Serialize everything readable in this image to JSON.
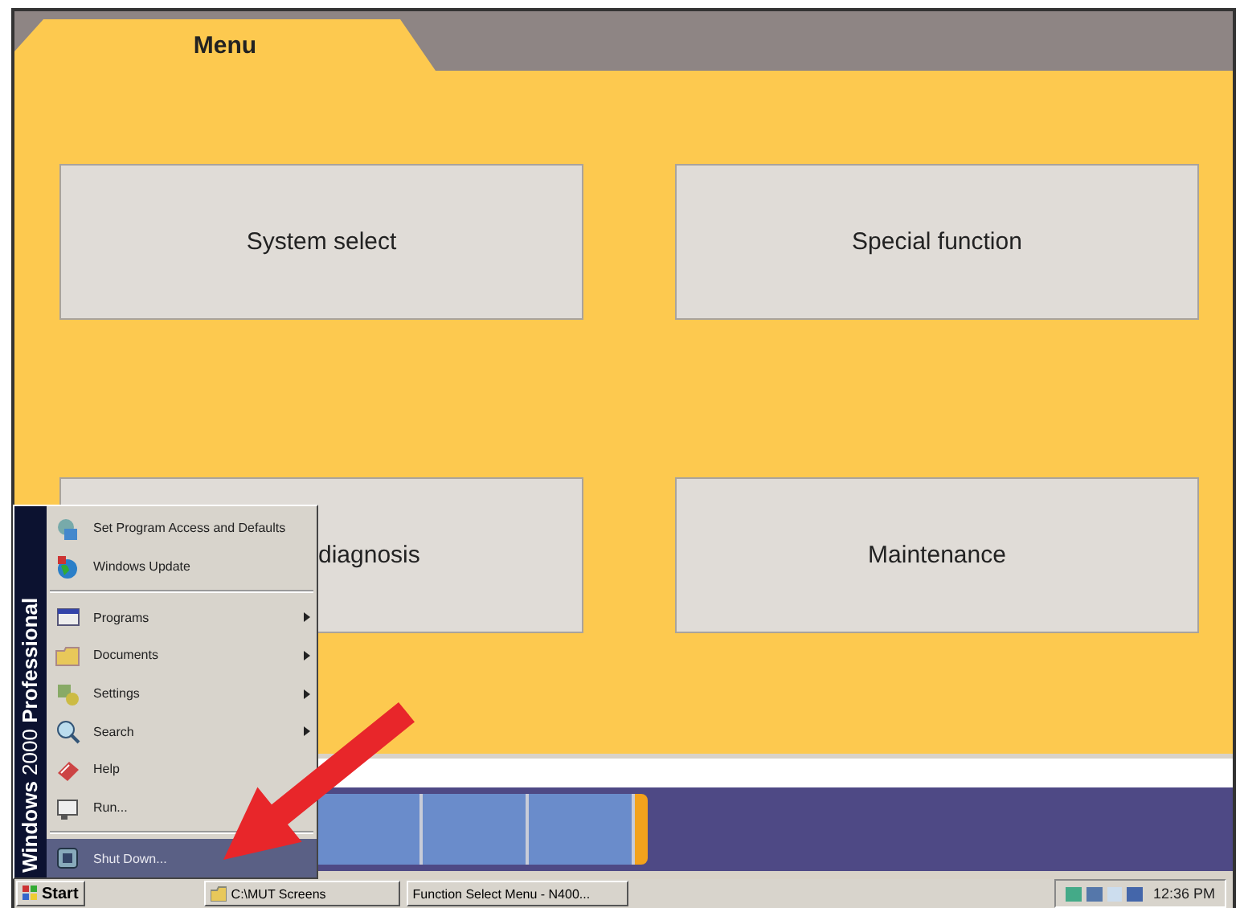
{
  "tabs": [
    {
      "label": "Menu",
      "selected": true
    }
  ],
  "menu_buttons": [
    {
      "label": "System select",
      "kind": "full"
    },
    {
      "label": "Special function",
      "kind": "full"
    },
    {
      "label": "diagnosis",
      "kind": "covered"
    },
    {
      "label": "Maintenance",
      "kind": "full"
    }
  ],
  "start_menu": {
    "banner": "**Windows** 2000 **Professional**",
    "items": [
      {
        "kind": "item",
        "label": "Set Program Access and Defaults",
        "submenu": false,
        "selected": false
      },
      {
        "kind": "item",
        "label": "Windows Update",
        "submenu": false,
        "selected": false
      },
      {
        "kind": "separator"
      },
      {
        "kind": "item",
        "label": "Programs",
        "submenu": true,
        "selected": false
      },
      {
        "kind": "item",
        "label": "Documents",
        "submenu": true,
        "selected": false
      },
      {
        "kind": "item",
        "label": "Settings",
        "submenu": true,
        "selected": false
      },
      {
        "kind": "item",
        "label": "Search",
        "submenu": true,
        "selected": false
      },
      {
        "kind": "item",
        "label": "Help",
        "submenu": false,
        "selected": false
      },
      {
        "kind": "item",
        "label": "Run...",
        "submenu": false,
        "selected": false
      },
      {
        "kind": "separator"
      },
      {
        "kind": "item",
        "label": "Shut Down...",
        "submenu": false,
        "selected": true
      }
    ]
  },
  "taskbar": {
    "start": "Start",
    "tasks": [
      {
        "label": "C:\\MUT Screens",
        "icon": true,
        "selected": false
      },
      {
        "label": "Function Select Menu - N400...",
        "icon": false,
        "selected": false
      }
    ],
    "clock": "12:36 PM"
  }
}
